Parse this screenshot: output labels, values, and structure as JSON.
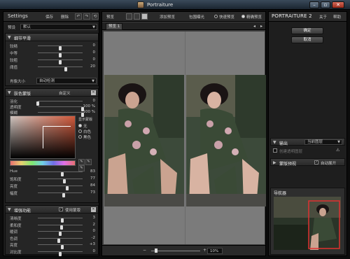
{
  "window": {
    "title": "Portraiture"
  },
  "left": {
    "settings_label": "Settings",
    "save_label": "保存",
    "delete_label": "删除",
    "preset_label": "预设",
    "preset_value": "默认",
    "detail": {
      "title": "细节平滑",
      "sliders": [
        {
          "label": "较精",
          "value": "0",
          "pos": 0.5
        },
        {
          "label": "中等",
          "value": "0",
          "pos": 0.5
        },
        {
          "label": "较粗",
          "value": "0",
          "pos": 0.5
        },
        {
          "label": "阈值",
          "value": "20",
          "pos": 0.62
        }
      ],
      "feature_label": "肖像大小",
      "feature_value": "自动检测"
    },
    "mask": {
      "title": "肤色蒙版",
      "mode_value": "自定义",
      "sliders": [
        {
          "label": "羽化",
          "value": "0",
          "pos": 0.0
        },
        {
          "label": "透明度",
          "value": "100 %",
          "pos": 1.0
        },
        {
          "label": "模糊",
          "value": "100 %",
          "pos": 1.0
        }
      ],
      "show_mask_label": "显示蒙版",
      "options": [
        "无",
        "白色",
        "黑色"
      ],
      "hsv": [
        {
          "label": "Hue",
          "value": "83",
          "pos": 0.55
        },
        {
          "label": "饱和度",
          "value": "77",
          "pos": 0.6
        },
        {
          "label": "亮度",
          "value": "84",
          "pos": 0.65
        },
        {
          "label": "幅度",
          "value": "73",
          "pos": 0.58
        }
      ]
    },
    "enhance": {
      "title": "增强功能",
      "use_mask_label": "使用蒙版",
      "sliders": [
        {
          "label": "清晰度",
          "value": "3",
          "pos": 0.55
        },
        {
          "label": "柔和度",
          "value": "2",
          "pos": 0.53
        },
        {
          "label": "暖调",
          "value": "0",
          "pos": 0.5
        },
        {
          "label": "色调",
          "value": "-2",
          "pos": 0.47
        },
        {
          "label": "亮度",
          "value": "+3",
          "pos": 0.55
        },
        {
          "label": "对比度",
          "value": "0",
          "pos": 0.5
        }
      ]
    }
  },
  "center": {
    "preview_label": "预览",
    "add_preview_label": "添加预览",
    "highlight_label": "包围曝光",
    "quick_preview_label": "快速预览",
    "precise_preview_label": "精确预览",
    "tab_label": "预览 1",
    "zoom_value": "10%"
  },
  "right": {
    "brand": "PORTRAITURE 2",
    "about_label": "关于",
    "help_label": "帮助",
    "ok_label": "确定",
    "cancel_label": "取消",
    "output_label": "输出",
    "output_value": "当前图层",
    "create_layer_label": "创建透明图层",
    "mask_preview_label": "蒙版预视",
    "auto_open_label": "自动展开",
    "navigator_label": "导航器"
  },
  "colors": {
    "panel": "#1e1e1e",
    "canvas": "#7b7b7b",
    "accent": "#d0583a"
  }
}
